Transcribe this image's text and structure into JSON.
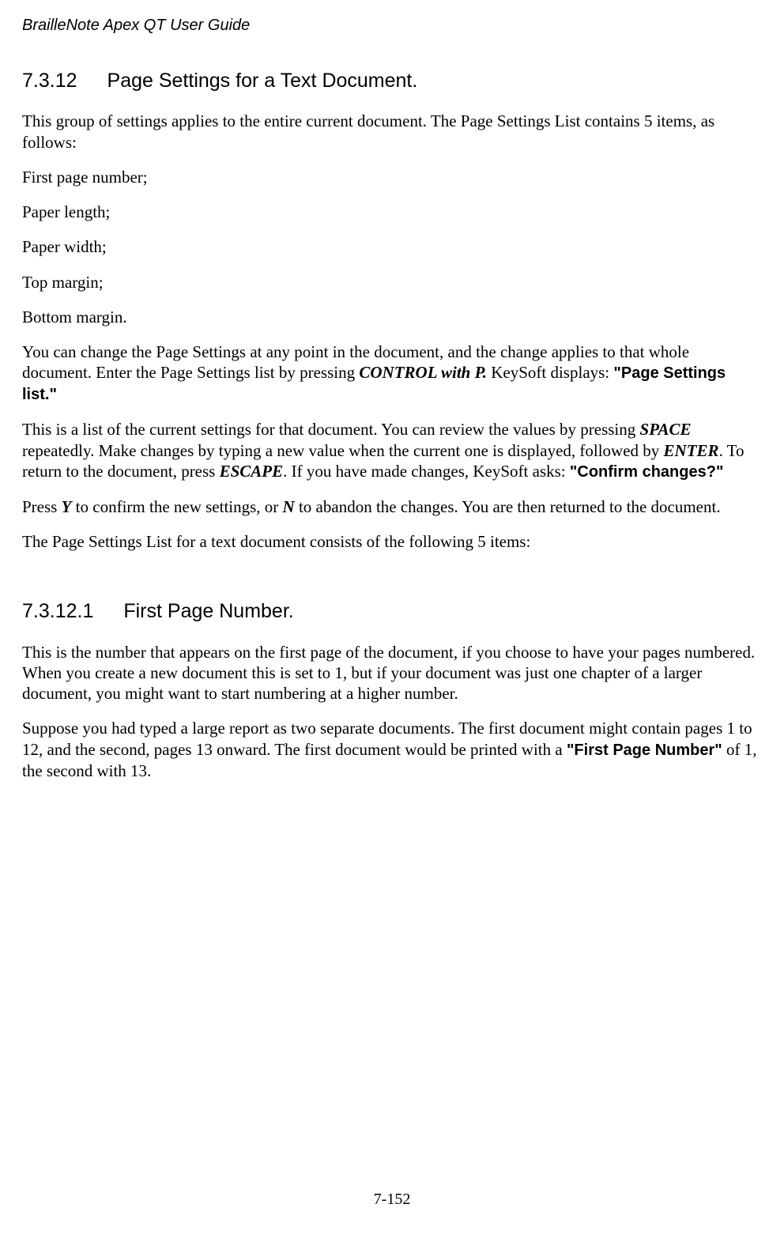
{
  "header": "BrailleNote Apex QT User Guide",
  "section1": {
    "number": "7.3.12",
    "title": "Page Settings for a Text Document."
  },
  "p_intro": "This group of settings applies to the entire current document. The Page Settings List contains 5 items, as follows:",
  "items": {
    "i1": "First page number;",
    "i2": "Paper length;",
    "i3": "Paper width;",
    "i4": "Top margin;",
    "i5": "Bottom margin."
  },
  "p_change_a": "You can change the Page Settings at any point in the document, and the change applies to that whole document. Enter the Page Settings list by pressing ",
  "control_with_p": "CONTROL with P.",
  "p_change_b": " KeySoft displays: ",
  "page_settings_quote": "\"Page Settings list.\"",
  "p_review_a": "This is a list of the current settings for that document. You can review the values by pressing ",
  "space_key": "SPACE",
  "p_review_b": " repeatedly. Make changes by typing a new value when the current one is displayed, followed by ",
  "enter_key": "ENTER",
  "p_review_c": ". To return to the document, press ",
  "escape_key": "ESCAPE",
  "p_review_d": ". If you have made changes, KeySoft asks: ",
  "confirm_quote": "\"Confirm changes?\"",
  "p_confirm_a": "Press ",
  "y_key": "Y",
  "p_confirm_b": " to confirm the new settings, or ",
  "n_key": "N",
  "p_confirm_c": " to abandon the changes. You are then returned to the document.",
  "p_list5": "The Page Settings List for a text document consists of the following 5 items:",
  "section2": {
    "number": "7.3.12.1",
    "title": "First Page Number."
  },
  "p_fp1": "This is the number that appears on the first page of the document, if you choose to have your pages numbered. When you create a new document this is set to 1, but if your document was just one chapter of a larger document, you might want to start numbering at a higher number.",
  "p_fp2_a": "Suppose you had typed a large report as two separate documents. The first document might contain pages 1 to 12, and the second, pages 13 onward. The first document would be printed with a ",
  "first_page_quote": "\"First Page Number\"",
  "p_fp2_b": " of 1, the second with 13.",
  "footer": "7-152"
}
